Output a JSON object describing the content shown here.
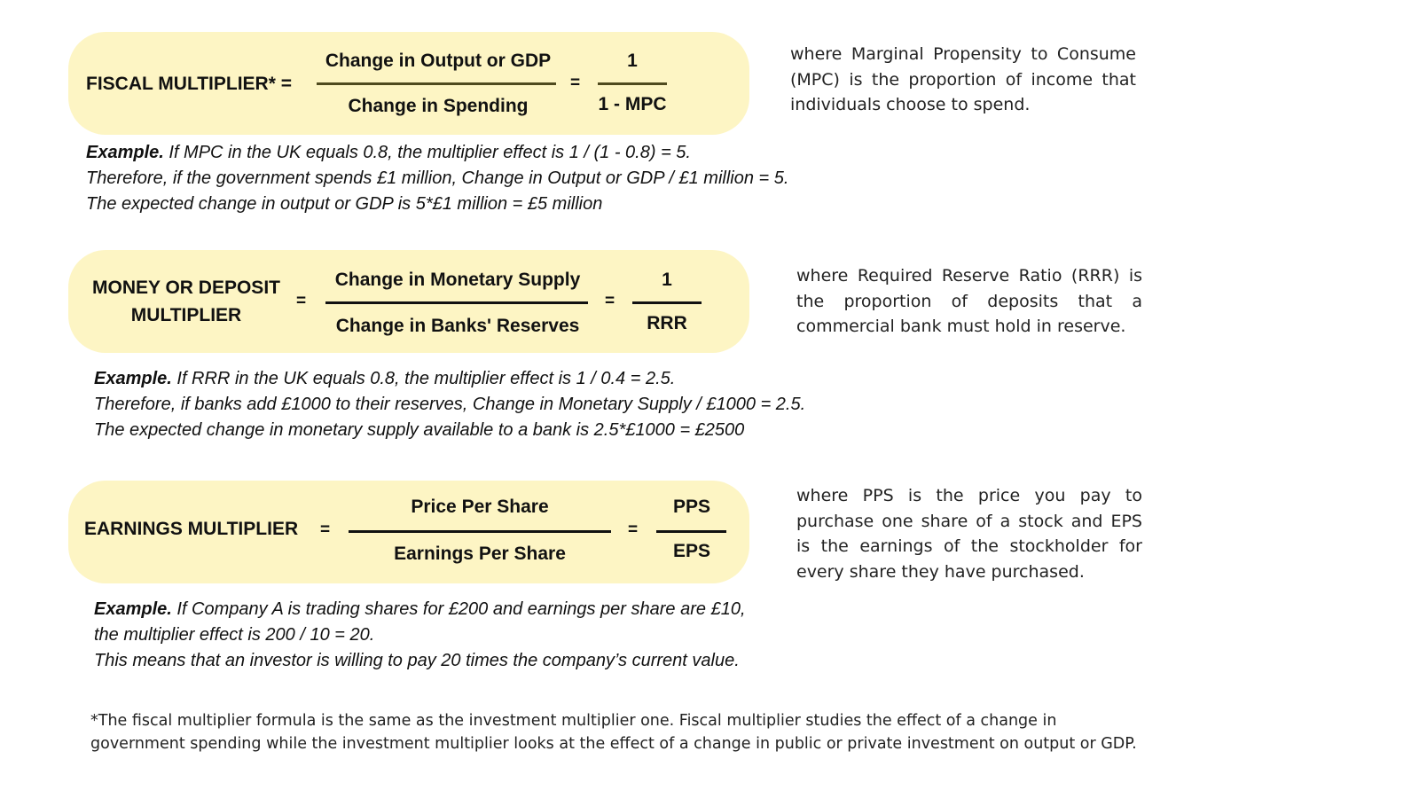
{
  "fiscal": {
    "label": "FISCAL MULTIPLIER* =",
    "numerator": "Change in Output or GDP",
    "denominator": "Change in Spending",
    "equals": "=",
    "simple_numerator": "1",
    "simple_denominator": "1 - MPC",
    "description": "where Marginal Propensity to Consume (MPC) is the proportion of income that individuals choose to spend.",
    "example_lead": "Example.",
    "example_lines": [
      " If MPC in the UK equals 0.8, the multiplier effect is 1 / (1 - 0.8) = 5.",
      "Therefore, if the government spends £1 million, Change in Output or GDP / £1 million = 5.",
      "The expected change in output or GDP is 5*£1 million = £5 million"
    ]
  },
  "money": {
    "label_line1": "MONEY OR DEPOSIT",
    "label_line2": "MULTIPLIER",
    "equals": "=",
    "numerator": "Change in Monetary Supply",
    "denominator": "Change in Banks' Reserves",
    "simple_numerator": "1",
    "simple_denominator": "RRR",
    "description": "where Required Reserve Ratio (RRR) is the proportion of deposits that a commercial bank must hold in reserve.",
    "example_lead": "Example.",
    "example_lines": [
      " If RRR in the UK equals 0.8, the multiplier effect is 1 / 0.4 = 2.5.",
      "Therefore, if banks add £1000 to their reserves, Change in Monetary Supply / £1000 = 2.5.",
      "The expected change in monetary supply available to a bank is 2.5*£1000 = £2500"
    ]
  },
  "earnings": {
    "label": "EARNINGS MULTIPLIER",
    "equals": "=",
    "numerator": "Price Per Share",
    "denominator": "Earnings Per Share",
    "simple_numerator": "PPS",
    "simple_denominator": "EPS",
    "description": "where PPS is the price you pay to purchase one share of a stock and EPS is the earnings of the stockholder for every share they have purchased.",
    "example_lead": "Example.",
    "example_lines": [
      " If Company A is trading shares for £200 and earnings per share are £10,",
      "the multiplier effect is 200 / 10 = 20.",
      "This means that an investor is willing to pay 20 times the company’s current value."
    ]
  },
  "footnote": "*The fiscal multiplier formula is the same as the investment multiplier one. Fiscal multiplier studies the effect of a change in government spending while the investment multiplier looks at the effect of a change in public or private investment on output or GDP.",
  "colors": {
    "box_background": "#fdf5c4",
    "text": "#111111"
  }
}
